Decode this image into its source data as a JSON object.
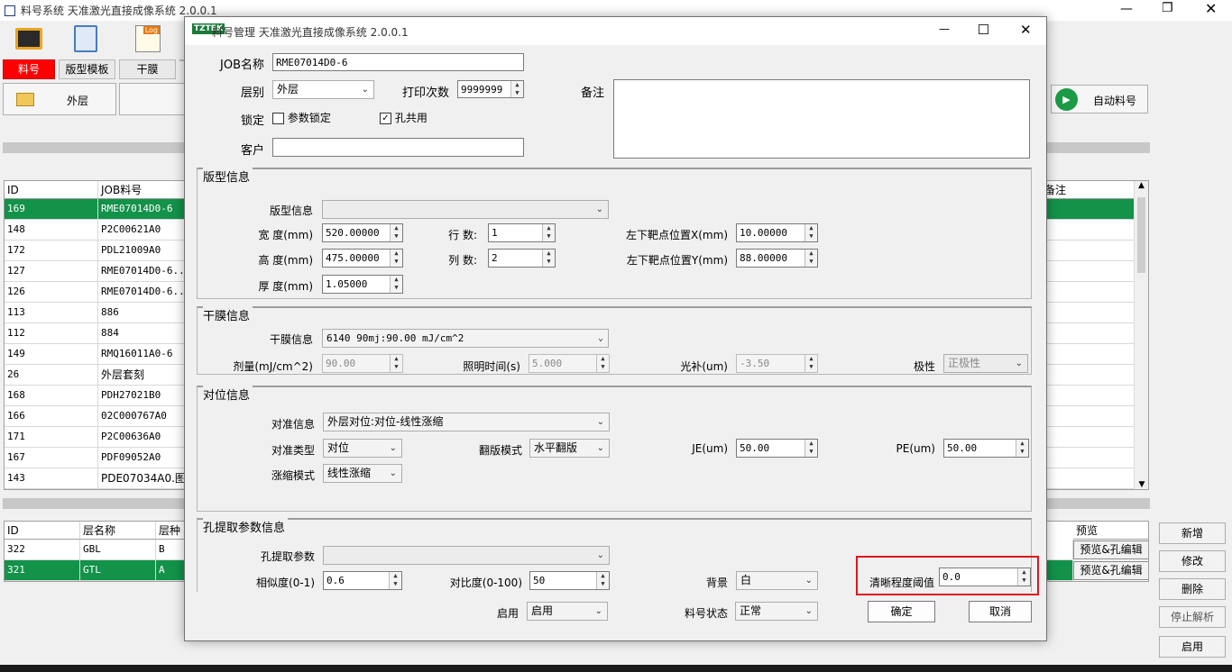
{
  "main_window": {
    "title": "料号系统 天准激光直接成像系统 2.0.0.1"
  },
  "tabs": [
    "料号",
    "版型模板",
    "干膜",
    ""
  ],
  "layer_button": "外层",
  "auto_button": "自动料号",
  "top_grid": {
    "headers": {
      "id": "ID",
      "job": "JOB料号",
      "remark": "备注"
    },
    "rows": [
      {
        "id": "169",
        "job": "RME07014D0-6",
        "selected": true
      },
      {
        "id": "148",
        "job": "P2C00621A0"
      },
      {
        "id": "172",
        "job": "PDL21009A0"
      },
      {
        "id": "127",
        "job": "RME07014D0-6..."
      },
      {
        "id": "126",
        "job": "RME07014D0-6..."
      },
      {
        "id": "113",
        "job": "886"
      },
      {
        "id": "112",
        "job": "884"
      },
      {
        "id": "149",
        "job": "RMQ16011A0-6"
      },
      {
        "id": "26",
        "job": "外层套刻"
      },
      {
        "id": "168",
        "job": "PDH27021B0"
      },
      {
        "id": "166",
        "job": "02C000767A0"
      },
      {
        "id": "171",
        "job": "P2C00636A0"
      },
      {
        "id": "167",
        "job": "PDF09052A0"
      },
      {
        "id": "143",
        "job": "PDE07034A0.图电"
      }
    ]
  },
  "bottom_grid": {
    "headers": {
      "id": "ID",
      "layer": "层名称",
      "type": "层种",
      "preview": "预览"
    },
    "rows": [
      {
        "id": "322",
        "layer": "GBL",
        "type": "B",
        "preview": "预览&孔编辑"
      },
      {
        "id": "321",
        "layer": "GTL",
        "type": "A",
        "preview": "预览&孔编辑",
        "selected": true
      }
    ]
  },
  "right_buttons": [
    "新增",
    "修改",
    "删除",
    "停止解析",
    "启用"
  ],
  "dialog": {
    "logo": "TZTEK",
    "title": "料号管理 天准激光直接成像系统 2.0.0.1",
    "job_label": "JOB名称",
    "job_value": "RME07014D0-6",
    "layer_label": "层别",
    "layer_value": "外层",
    "print_label": "打印次数",
    "print_value": "9999999",
    "lock_label": "锁定",
    "param_lock": "参数锁定",
    "hole_share": "孔共用",
    "customer_label": "客户",
    "customer_value": "",
    "remark_label": "备注",
    "panel": {
      "title": "版型信息",
      "info_label": "版型信息",
      "info_value": "",
      "width_label": "宽 度(mm)",
      "width_value": "520.00000",
      "height_label": "高 度(mm)",
      "height_value": "475.00000",
      "thick_label": "厚 度(mm)",
      "thick_value": "1.05000",
      "rows_label": "行 数:",
      "rows_value": "1",
      "cols_label": "列 数:",
      "cols_value": "2",
      "tx_label": "左下靶点位置X(mm)",
      "tx_value": "10.00000",
      "ty_label": "左下靶点位置Y(mm)",
      "ty_value": "88.00000"
    },
    "film": {
      "title": "干膜信息",
      "info_label": "干膜信息",
      "info_value": "6140 90mj:90.00 mJ/cm^2",
      "dose_label": "剂量(mJ/cm^2)",
      "dose_value": "90.00",
      "time_label": "照明时间(s)",
      "time_value": "5.000",
      "comp_label": "光补(um)",
      "comp_value": "-3.50",
      "pol_label": "极性",
      "pol_value": "正极性"
    },
    "align": {
      "title": "对位信息",
      "info_label": "对准信息",
      "info_value": "外层对位:对位-线性涨缩",
      "type_label": "对准类型",
      "type_value": "对位",
      "flip_label": "翻版模式",
      "flip_value": "水平翻版",
      "je_label": "JE(um)",
      "je_value": "50.00",
      "pe_label": "PE(um)",
      "pe_value": "50.00",
      "scale_label": "涨缩模式",
      "scale_value": "线性涨缩"
    },
    "hole": {
      "title": "孔提取参数信息",
      "param_label": "孔提取参数",
      "param_value": "",
      "sim_label": "相似度(0-1)",
      "sim_value": "0.6",
      "contrast_label": "对比度(0-100)",
      "contrast_value": "50",
      "bg_label": "背景",
      "bg_value": "白",
      "clarity_label": "清晰程度阈值",
      "clarity_value": "0.0"
    },
    "enable_label": "启用",
    "enable_value": "启用",
    "status_label": "料号状态",
    "status_value": "正常",
    "ok": "确定",
    "cancel": "取消"
  }
}
